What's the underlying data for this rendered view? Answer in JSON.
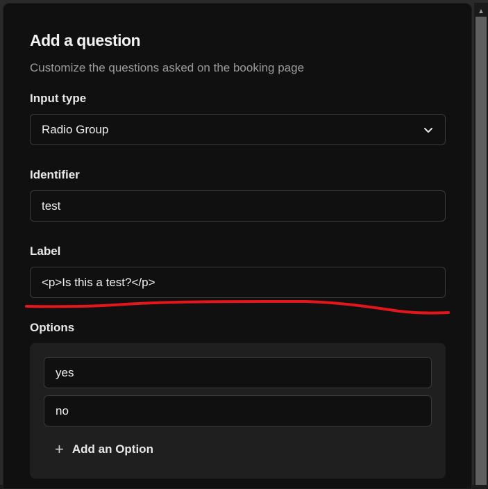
{
  "dialog": {
    "title": "Add a question",
    "subtitle": "Customize the questions asked on the booking page"
  },
  "input_type": {
    "label": "Input type",
    "value": "Radio Group",
    "icon": "chevron-down-icon"
  },
  "identifier": {
    "label": "Identifier",
    "value": "test"
  },
  "label_field": {
    "label": "Label",
    "value": "<p>Is this a test?</p>"
  },
  "options": {
    "label": "Options",
    "items": [
      "yes",
      "no"
    ],
    "add_label": "Add an Option",
    "add_icon": "plus-icon"
  },
  "annotation": {
    "color": "#e3161b"
  },
  "scrollbar": {
    "arrow_icon": "scroll-up-arrow-icon"
  }
}
